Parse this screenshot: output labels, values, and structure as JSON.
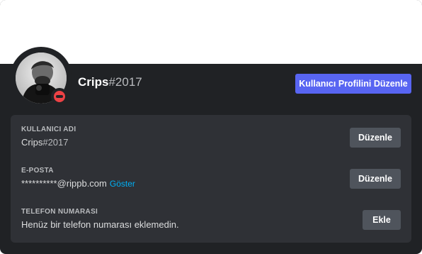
{
  "profile": {
    "username": "Crips",
    "discriminator": "#2017",
    "edit_profile_label": "Kullanıcı Profilini Düzenle",
    "status": "do-not-disturb",
    "banner_color": "#ffffff",
    "accent_color": "#5865f2",
    "status_color": "#ed4245"
  },
  "fields": {
    "username": {
      "label": "KULLANICI ADI",
      "name": "Crips",
      "discriminator": "#2017",
      "button_label": "Düzenle"
    },
    "email": {
      "label": "E-POSTA",
      "value": "**********@rippb.com",
      "reveal_label": "Göster",
      "button_label": "Düzenle"
    },
    "phone": {
      "label": "TELEFON NUMARASI",
      "value": "Henüz bir telefon numarası eklemedin.",
      "button_label": "Ekle"
    }
  }
}
